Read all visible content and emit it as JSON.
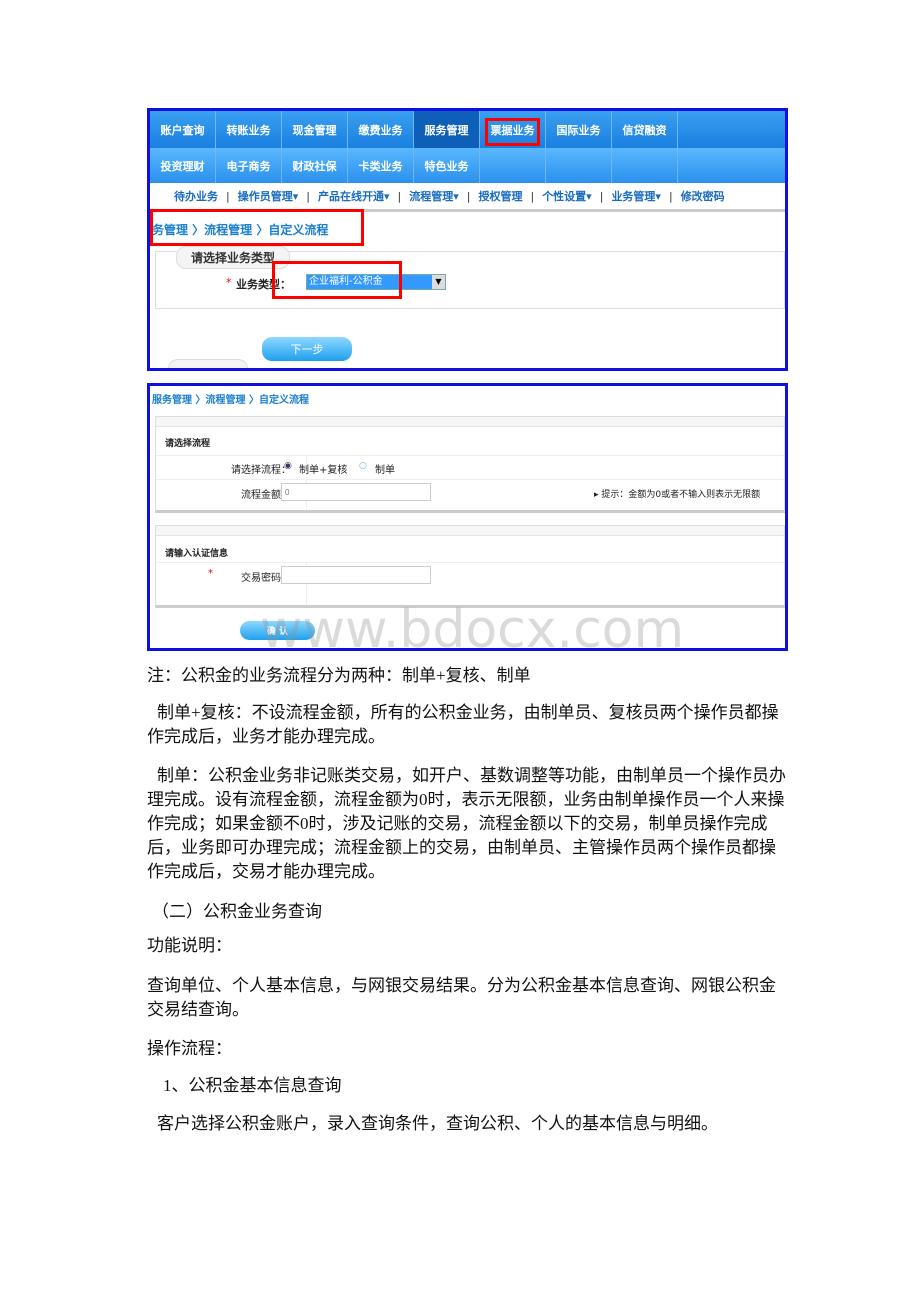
{
  "screenshot1": {
    "nav_row1": [
      "账户查询",
      "转账业务",
      "现金管理",
      "缴费业务",
      "服务管理",
      "票据业务",
      "国际业务",
      "信贷融资"
    ],
    "nav_row2": [
      "投资理财",
      "电子商务",
      "财政社保",
      "卡类业务",
      "特色业务"
    ],
    "active_nav": "服务管理",
    "submenu": [
      "待办业务",
      "操作员管理▾",
      "产品在线开通▾",
      "流程管理▾",
      "授权管理",
      "个性设置▾",
      "业务管理▾",
      "修改密码"
    ],
    "breadcrumb": "务管理 〉流程管理 〉自定义流程",
    "section_title": "请选择业务类型",
    "required_mark": "*",
    "business_type_label": "业务类型：",
    "business_type_value": "企业福利-公积金",
    "next_button": "下一步",
    "highlight_color": "#ff0000",
    "accent": "#1a7fe0"
  },
  "screenshot2": {
    "breadcrumb": "服务管理 〉流程管理 〉自定义流程",
    "panel1_title": "请选择流程",
    "flow_label": "请选择流程：",
    "flow_options": [
      "制单+复核",
      "制单"
    ],
    "flow_selected": "制单+复核",
    "amount_label": "流程金额：",
    "amount_placeholder": "0",
    "hint": "▸ 提示：金额为0或者不输入则表示无限额",
    "panel2_title": "请输入认证信息",
    "required_mark": "*",
    "password_label": "交易密码：",
    "confirm_button": "确 认",
    "watermark": "www.bdocx.com"
  },
  "paragraphs": [
    "注：公积金的业务流程分为两种：制单+复核、制单",
    "制单+复核：不设流程金额，所有的公积金业务，由制单员、复核员两个操作员都操作完成后，业务才能办理完成。",
    "制单：公积金业务非记账类交易，如开户、基数调整等功能，由制单员一个操作员办理完成。设有流程金额，流程金额为0时，表示无限额，业务由制单操作员一个人来操作完成；如果金额不0时，涉及记账的交易，流程金额以下的交易，制单员操作完成后，业务即可办理完成；流程金额上的交易，由制单员、主管操作员两个操作员都操作完成后，交易才能办理完成。",
    "（二）公积金业务查询",
    "功能说明：",
    "查询单位、个人基本信息，与网银交易结果。分为公积金基本信息查询、网银公积金交易结查询。",
    "操作流程：",
    "1、公积金基本信息查询",
    "客户选择公积金账户，录入查询条件，查询公积、个人的基本信息与明细。"
  ]
}
